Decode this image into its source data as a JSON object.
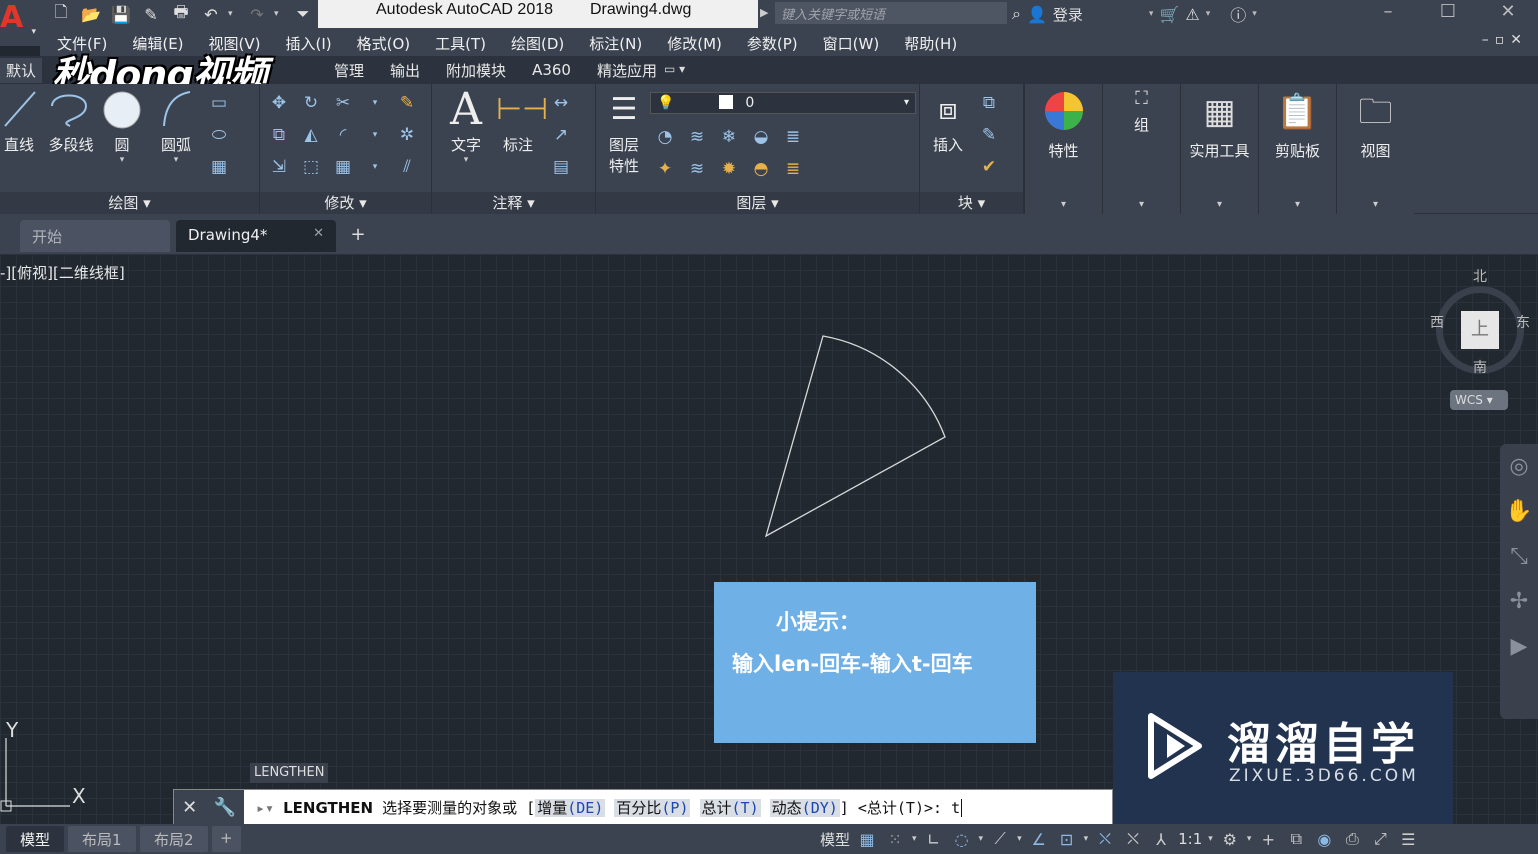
{
  "titlebar": {
    "app_name": "Autodesk AutoCAD 2018",
    "file_name": "Drawing4.dwg",
    "search_placeholder": "键入关键字或短语",
    "login": "登录"
  },
  "menu": [
    "文件(F)",
    "编辑(E)",
    "视图(V)",
    "插入(I)",
    "格式(O)",
    "工具(T)",
    "绘图(D)",
    "标注(N)",
    "修改(M)",
    "参数(P)",
    "窗口(W)",
    "帮助(H)"
  ],
  "ribbon_tabs": {
    "active": "默认",
    "items": [
      "管理",
      "输出",
      "附加模块",
      "A360",
      "精选应用"
    ]
  },
  "watermark_text": "秒dong视频",
  "ribbon": {
    "draw": {
      "title": "绘图",
      "line": "直线",
      "polyline": "多段线",
      "circle": "圆",
      "arc": "圆弧"
    },
    "modify": {
      "title": "修改"
    },
    "annotation": {
      "title": "注释",
      "text": "文字",
      "dimension": "标注"
    },
    "layers": {
      "title": "图层",
      "layer_props_1": "图层",
      "layer_props_2": "特性",
      "current_layer": "0"
    },
    "block": {
      "title": "块",
      "insert": "插入"
    },
    "properties": "特性",
    "group": "组",
    "utilities": "实用工具",
    "clipboard": "剪贴板",
    "view": "视图"
  },
  "file_tabs": {
    "start": "开始",
    "drawing": "Drawing4*"
  },
  "viewport_label": "-][俯视][二维线框]",
  "viewcube": {
    "north": "北",
    "south": "南",
    "east": "东",
    "west": "西",
    "top": "上",
    "wcs": "WCS"
  },
  "ucs": {
    "y": "Y",
    "x": "X"
  },
  "hint": {
    "title": "小提示：",
    "body": "输入len-回车-输入t-回车"
  },
  "zixue": {
    "brand": "溜溜自学",
    "domain": "ZIXUE.3D66.COM"
  },
  "command_label": "LENGTHEN",
  "command": {
    "name": "LENGTHEN",
    "prompt": "选择要测量的对象或",
    "options": [
      {
        "label": "增量",
        "key": "(DE)"
      },
      {
        "label": "百分比",
        "key": "(P)"
      },
      {
        "label": "总计",
        "key": "(T)"
      },
      {
        "label": "动态",
        "key": "(DY)"
      }
    ],
    "default": "<总计(T)>:",
    "input": "t"
  },
  "layout_tabs": [
    "模型",
    "布局1",
    "布局2"
  ],
  "status": {
    "model": "模型",
    "scale": "1:1"
  },
  "colors": {
    "canvas": "#212830",
    "hint_bg": "#6fb0e6",
    "brand_bg": "#223350",
    "accent_red": "#e2362b"
  }
}
